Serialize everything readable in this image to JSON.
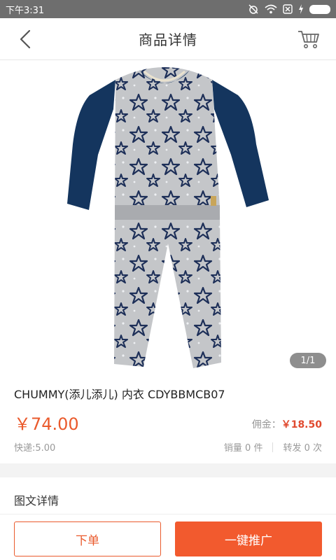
{
  "status_bar": {
    "time": "下午3:31",
    "icons": [
      "alarm-off-icon",
      "wifi-icon",
      "sim-icon",
      "charging-icon",
      "battery-icon"
    ]
  },
  "nav": {
    "title": "商品详情",
    "back_icon": "chevron-left-icon",
    "cart_icon": "cart-icon"
  },
  "gallery": {
    "page_indicator": "1/1",
    "image": "kids-pajama-set-navy-stars"
  },
  "product": {
    "name": "CHUMMY(添儿添儿) 内衣 CDYBBMCB07",
    "price": "￥74.00",
    "commission_label": "佣金：",
    "commission_value": "￥18.50",
    "shipping": "快递:5.00",
    "sales": "销量 0 件",
    "reposts": "转发 0 次"
  },
  "details": {
    "label": "图文详情"
  },
  "actions": {
    "order_label": "下单",
    "promote_label": "一键推广"
  },
  "colors": {
    "accent": "#ea5a2c",
    "promote_bg": "#f25a2e",
    "status_bar": "#6e6e6e"
  }
}
